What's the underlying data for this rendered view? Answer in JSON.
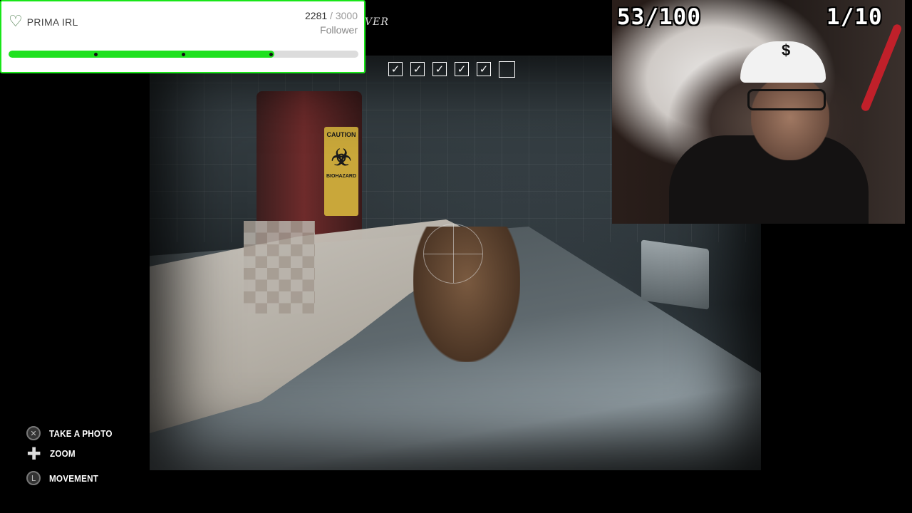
{
  "goal_widget": {
    "brand_name": "PRIMA IRL",
    "current": "2281",
    "separator_total": " / 3000",
    "unit": "Follower",
    "progress_fraction": 0.7603,
    "milestones_fraction": [
      0.25,
      0.5,
      0.75
    ],
    "accent_color": "#19e619"
  },
  "objective_partial": "VER",
  "checklist": [
    {
      "checked": true
    },
    {
      "checked": true
    },
    {
      "checked": true
    },
    {
      "checked": true
    },
    {
      "checked": true
    },
    {
      "checked": false
    }
  ],
  "check_glyph": "✓",
  "counters": {
    "left": "53/100",
    "right": "1/10"
  },
  "controls": [
    {
      "icon": "cross-button-icon",
      "glyph": "✕",
      "label": "TAKE A PHOTO"
    },
    {
      "icon": "dpad-icon",
      "glyph": "✚",
      "label": "ZOOM"
    },
    {
      "icon": "left-stick-icon",
      "glyph": "L",
      "label": "MOVEMENT"
    }
  ],
  "scene": {
    "bin_label": "CAUTION",
    "bin_label_bottom": "BIOHAZARD",
    "biohazard_glyph": "☣"
  }
}
